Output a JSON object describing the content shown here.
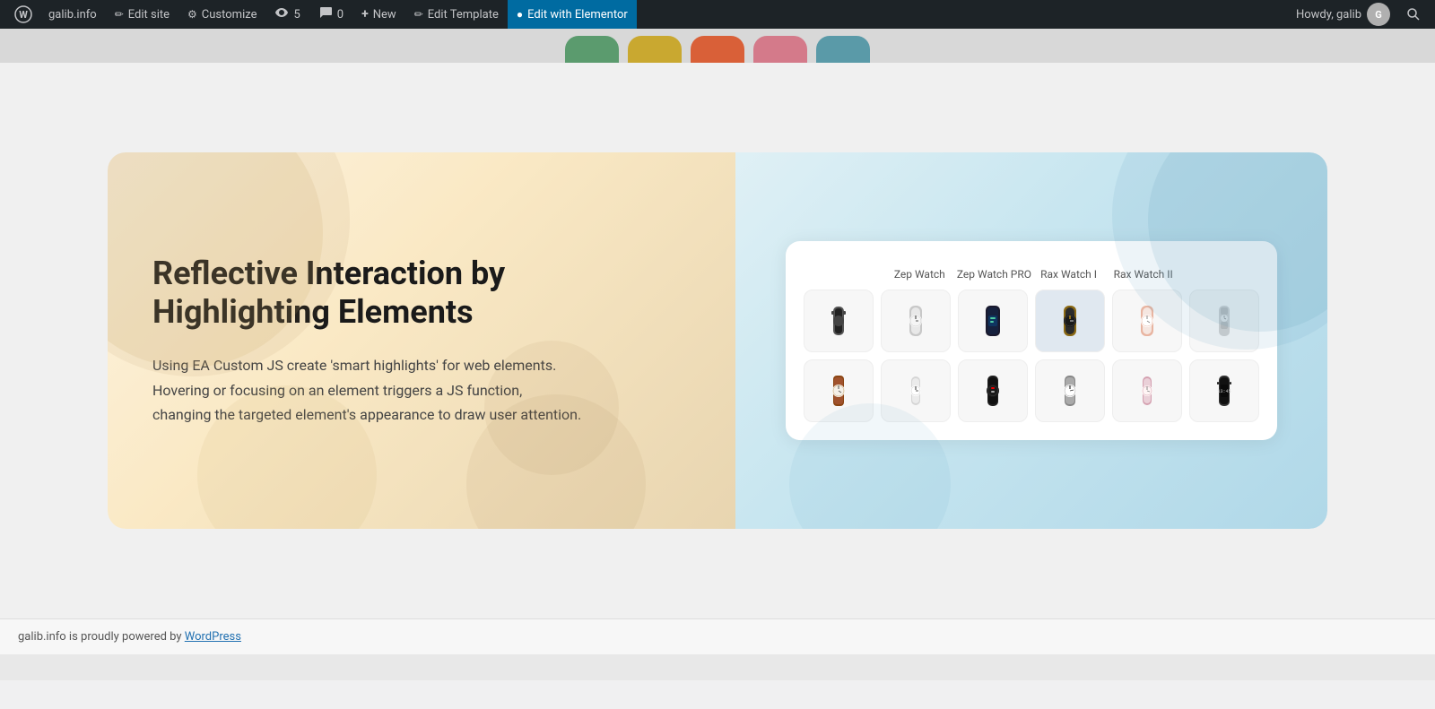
{
  "adminbar": {
    "site_name": "galib.info",
    "wp_icon": "⊞",
    "edit_site_label": "Edit site",
    "customize_label": "Customize",
    "views_count": "5",
    "comments_count": "0",
    "new_label": "New",
    "edit_template_label": "Edit Template",
    "edit_elementor_label": "Edit with Elementor",
    "howdy_text": "Howdy, galib",
    "search_title": "Search"
  },
  "nav_pills": [
    {
      "color": "green",
      "label": ""
    },
    {
      "color": "yellow",
      "label": ""
    },
    {
      "color": "orange",
      "label": ""
    },
    {
      "color": "pink",
      "label": ""
    },
    {
      "color": "teal",
      "label": ""
    }
  ],
  "hero": {
    "heading": "Reflective Interaction by Highlighting Elements",
    "description": "Using EA Custom JS create 'smart highlights' for web elements. Hovering or focusing on an element triggers a JS function, changing the targeted element's appearance to draw user attention."
  },
  "watch_grid": {
    "col_headers": [
      "",
      "Zep Watch",
      "Zep Watch PRO",
      "Rax Watch I",
      "Rax Watch II",
      ""
    ],
    "rows": [
      [
        {
          "type": "watch",
          "style": "dark-small"
        },
        {
          "type": "watch",
          "style": "silver-analog"
        },
        {
          "type": "watch",
          "style": "dark-digital"
        },
        {
          "type": "watch",
          "style": "dark-large",
          "highlighted": true
        },
        {
          "type": "watch",
          "style": "rose-gold"
        },
        {
          "type": "watch",
          "style": "silver-bracelet"
        }
      ],
      [
        {
          "type": "watch",
          "style": "brown-leather"
        },
        {
          "type": "watch",
          "style": "silver-small"
        },
        {
          "type": "watch",
          "style": "dark-round"
        },
        {
          "type": "watch",
          "style": "white-dial"
        },
        {
          "type": "watch",
          "style": "rose-small"
        },
        {
          "type": "watch",
          "style": "dark-digital-2"
        }
      ]
    ]
  },
  "footer": {
    "text": "galib.info is proudly powered by ",
    "link_text": "WordPress",
    "link_url": "#"
  }
}
